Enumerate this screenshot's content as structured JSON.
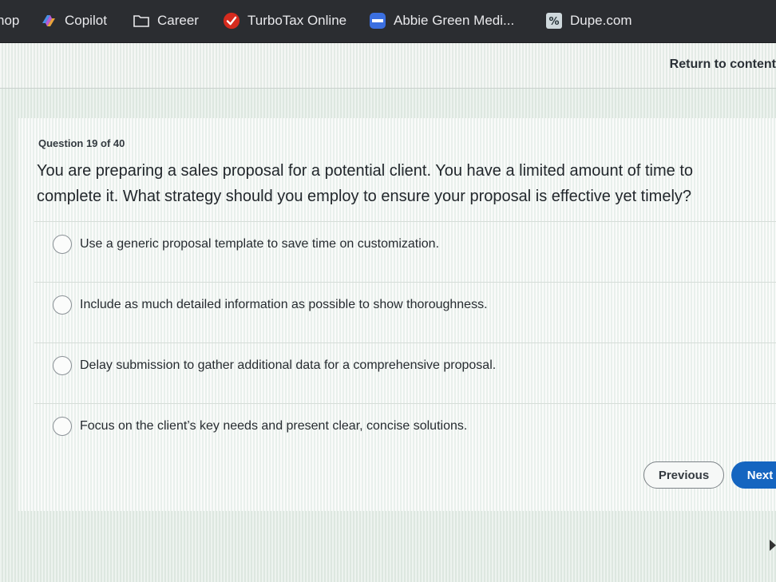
{
  "bookmarks": [
    {
      "label": "hop",
      "icon": "partial-bookmark"
    },
    {
      "label": "Copilot",
      "icon": "copilot-icon"
    },
    {
      "label": "Career",
      "icon": "folder-icon"
    },
    {
      "label": "TurboTax Online",
      "icon": "turbotax-check-icon"
    },
    {
      "label": "Abbie Green Medi...",
      "icon": "medical-icon"
    },
    {
      "label": "Dupe.com",
      "icon": "dupe-icon"
    }
  ],
  "header": {
    "return_link": "Return to content"
  },
  "quiz": {
    "counter": "Question 19 of 40",
    "question": "You are preparing a sales proposal for a potential client. You have a limited amount of time to complete it. What strategy should you employ to ensure your proposal is effective yet timely?",
    "options": [
      {
        "label": "Use a generic proposal template to save time on customization.",
        "selected": false
      },
      {
        "label": "Include as much detailed information as possible to show thoroughness.",
        "selected": false
      },
      {
        "label": "Delay submission to gather additional data for a comprehensive proposal.",
        "selected": false
      },
      {
        "label": "Focus on the client’s key needs and present clear, concise solutions.",
        "selected": false
      }
    ],
    "previous_label": "Previous",
    "next_label": "Next"
  },
  "colors": {
    "bookmarks_bg": "#2b2d31",
    "next_button": "#1565c0",
    "turbotax_red": "#d52b1e"
  }
}
